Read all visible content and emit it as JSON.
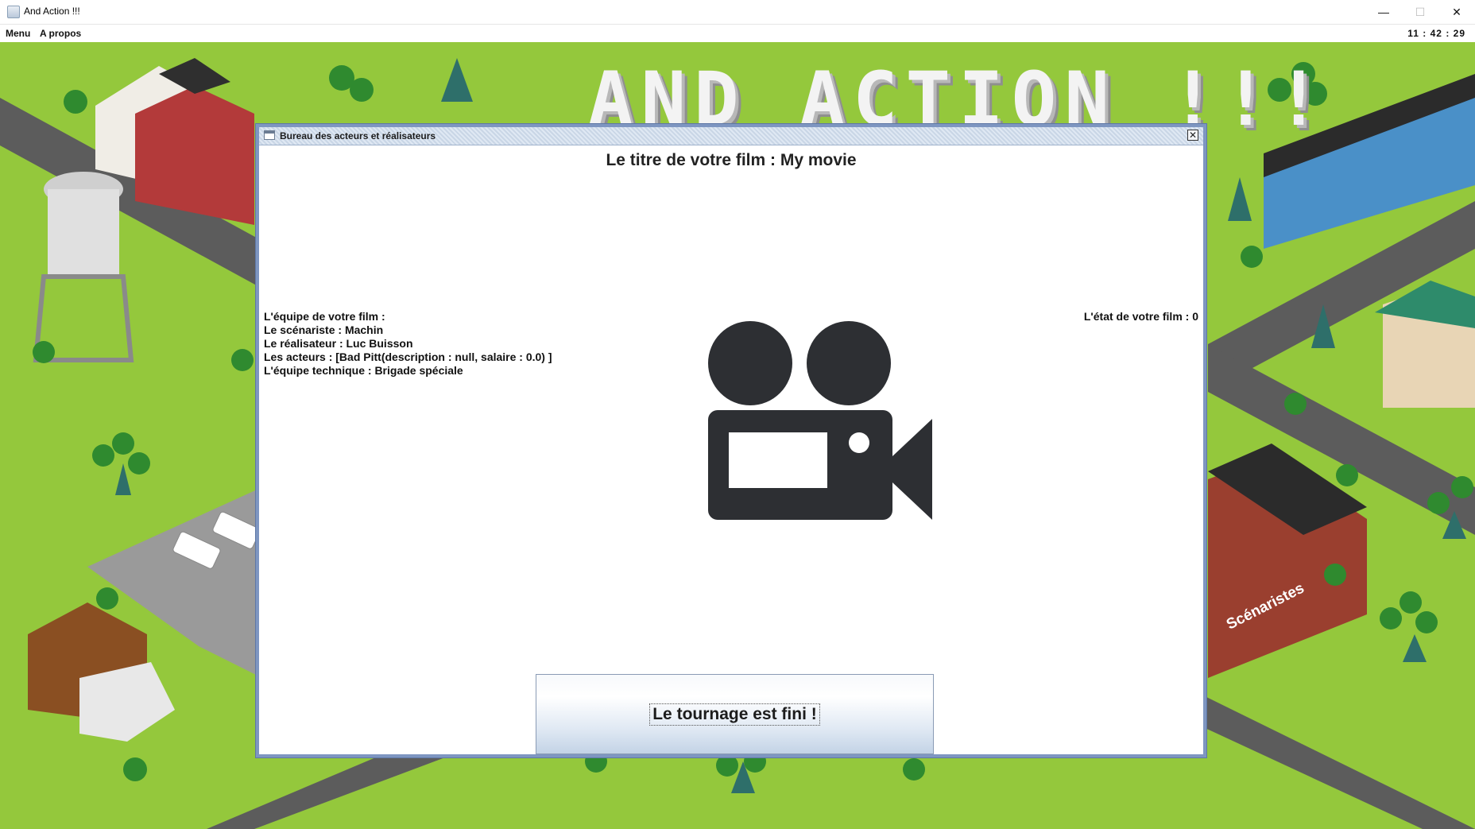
{
  "window": {
    "title": "And Action !!!",
    "minimize": "—",
    "maximize": "☐",
    "close": "✕"
  },
  "menubar": {
    "items": [
      "Menu",
      "A propos"
    ],
    "clock": "11 : 42 : 29"
  },
  "map": {
    "logo": "AND ACTION !!!",
    "label_writers": "Scénaristes"
  },
  "dialog": {
    "title": "Bureau des acteurs et réalisateurs",
    "film_title": "Le titre de votre film : My movie",
    "crew": {
      "header": "L'équipe de votre film :",
      "writer": "Le scénariste : Machin",
      "director": "Le réalisateur : Luc Buisson",
      "actors": "Les acteurs : [Bad Pitt(description : null, salaire : 0.0) ]",
      "tech": "L'équipe technique : Brigade spéciale"
    },
    "state": "L'état de votre film : 0",
    "finish_button": "Le tournage est fini !",
    "camera_icon": "movie-camera-icon"
  }
}
